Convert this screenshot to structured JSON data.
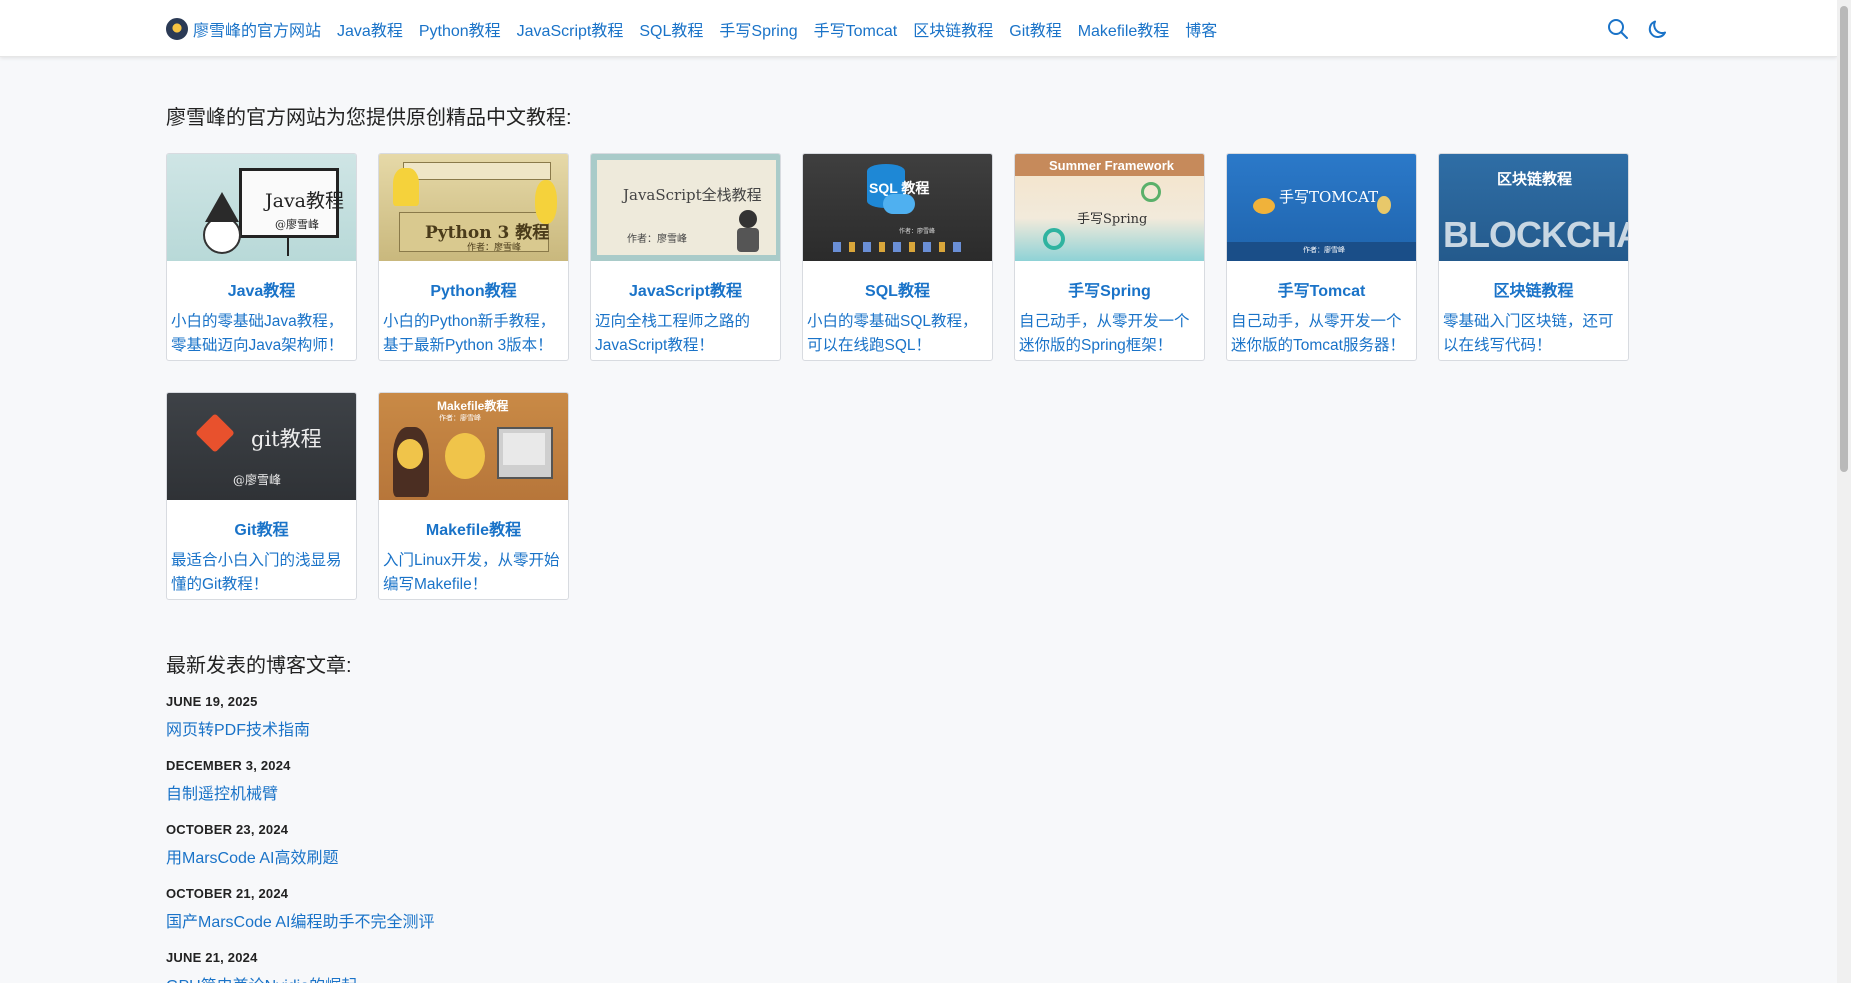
{
  "nav": {
    "brand": "廖雪峰的官方网站",
    "items": [
      "Java教程",
      "Python教程",
      "JavaScript教程",
      "SQL教程",
      "手写Spring",
      "手写Tomcat",
      "区块链教程",
      "Git教程",
      "Makefile教程",
      "博客"
    ]
  },
  "intro": "廖雪峰的官方网站为您提供原创精品中文教程:",
  "courses": [
    {
      "title": "Java教程",
      "desc": "小白的零基础Java教程，零基础迈向Java架构师！",
      "img_text": "Java教程",
      "img_sub": "@廖雪峰"
    },
    {
      "title": "Python教程",
      "desc": "小白的Python新手教程，基于最新Python 3版本！",
      "img_text": "Python 3 教程",
      "img_sub": "作者：廖雪峰"
    },
    {
      "title": "JavaScript教程",
      "desc": "迈向全栈工程师之路的JavaScript教程！",
      "img_text": "JavaScript全栈教程",
      "img_sub": "作者：廖雪峰"
    },
    {
      "title": "SQL教程",
      "desc": "小白的零基础SQL教程，可以在线跑SQL！",
      "img_text": "SQL 教程",
      "img_sub": "作者：廖雪峰"
    },
    {
      "title": "手写Spring",
      "desc": "自己动手，从零开发一个迷你版的Spring框架！",
      "img_text": "Summer Framework",
      "img_sub": "手写Spring"
    },
    {
      "title": "手写Tomcat",
      "desc": "自己动手，从零开发一个迷你版的Tomcat服务器！",
      "img_text": "手写TOMCAT",
      "img_sub": "作者：廖雪峰"
    },
    {
      "title": "区块链教程",
      "desc": "零基础入门区块链，还可以在线写代码！",
      "img_text": "区块链教程",
      "img_sub": "BLOCKCHAIN"
    },
    {
      "title": "Git教程",
      "desc": "最适合小白入门的浅显易懂的Git教程！",
      "img_text": "git教程",
      "img_sub": "@廖雪峰"
    },
    {
      "title": "Makefile教程",
      "desc": "入门Linux开发，从零开始编写Makefile！",
      "img_text": "Makefile教程",
      "img_sub": "作者：廖雪峰"
    }
  ],
  "blog_heading": "最新发表的博客文章:",
  "posts": [
    {
      "date": "JUNE 19, 2025",
      "title": "网页转PDF技术指南"
    },
    {
      "date": "DECEMBER 3, 2024",
      "title": "自制遥控机械臂"
    },
    {
      "date": "OCTOBER 23, 2024",
      "title": "用MarsCode AI高效刷题"
    },
    {
      "date": "OCTOBER 21, 2024",
      "title": "国产MarsCode AI编程助手不完全测评"
    },
    {
      "date": "JUNE 21, 2024",
      "title": "GPU简史兼论Nvidia的崛起"
    }
  ],
  "icons": {
    "search": "search-icon",
    "theme": "moon-icon"
  },
  "colors": {
    "link": "#1a73c8"
  }
}
